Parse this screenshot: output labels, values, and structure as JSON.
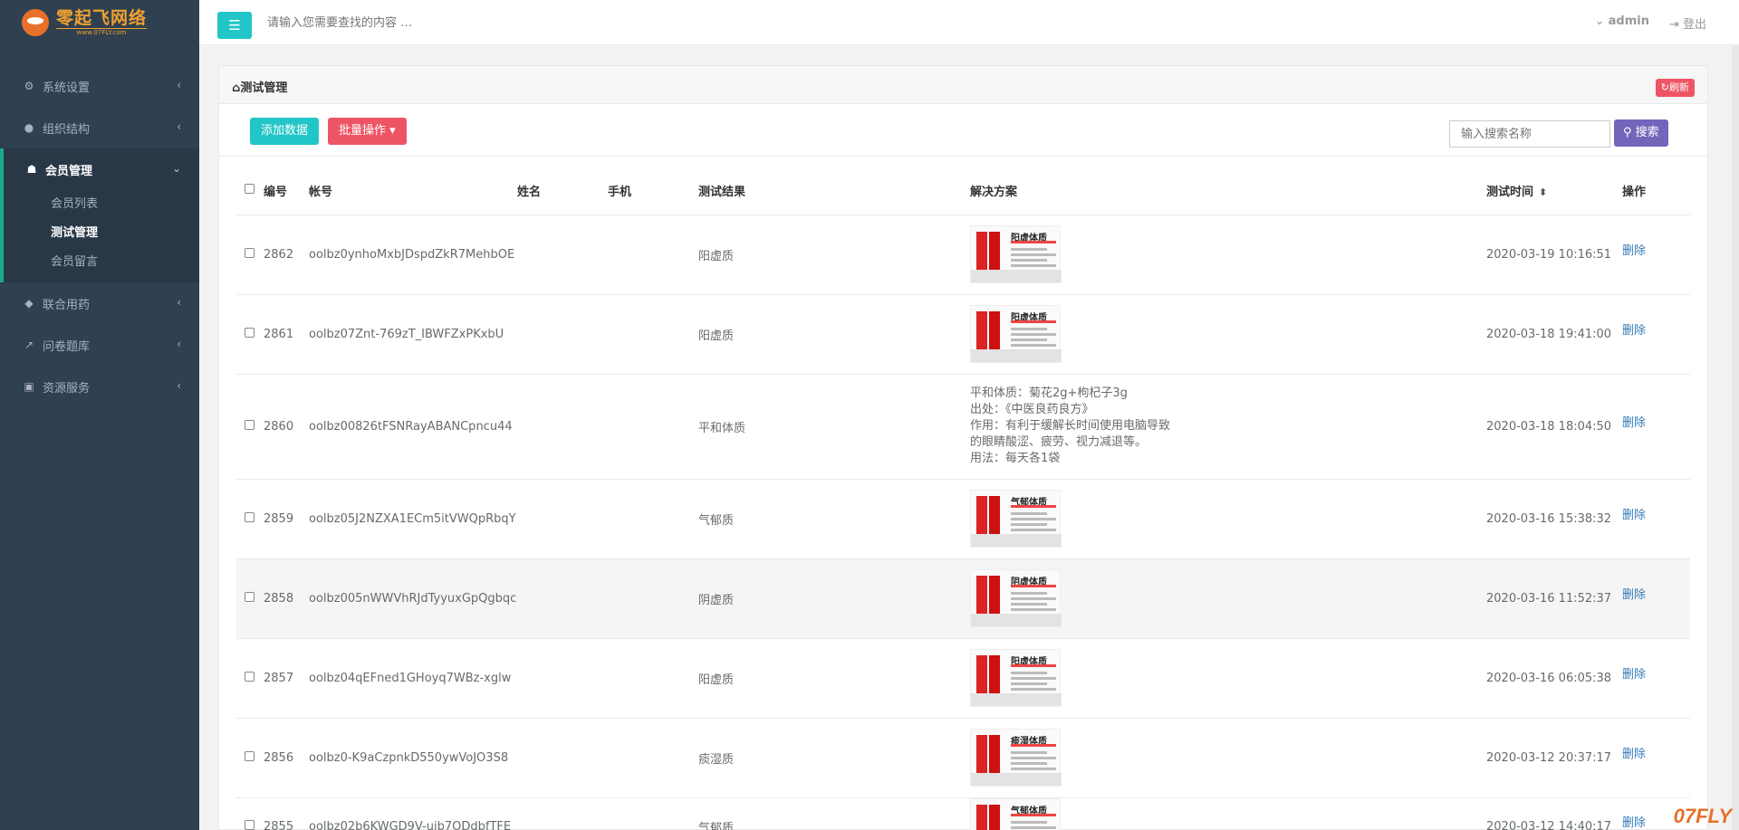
{
  "sidebar": {
    "logo_main": "零起飞网络",
    "logo_sub": "www.07FLY.com",
    "items": [
      {
        "label": "系统设置",
        "icon": "gears-icon",
        "glyph": "⚙"
      },
      {
        "label": "组织结构",
        "icon": "user-icon",
        "glyph": "●"
      },
      {
        "label": "会员管理",
        "icon": "users-icon",
        "glyph": "☗",
        "active": true,
        "sub": [
          {
            "label": "会员列表"
          },
          {
            "label": "测试管理",
            "current": true
          },
          {
            "label": "会员留言"
          }
        ]
      },
      {
        "label": "联合用药",
        "icon": "user-secret-icon",
        "glyph": "◆"
      },
      {
        "label": "问卷题库",
        "icon": "line-chart-icon",
        "glyph": "↗"
      },
      {
        "label": "资源服务",
        "icon": "cube-icon",
        "glyph": "▣"
      }
    ]
  },
  "topbar": {
    "search_placeholder": "请输入您需要查找的内容 …",
    "user": "admin",
    "logout": "登出"
  },
  "panel": {
    "title": "测试管理",
    "refresh": "刷新"
  },
  "toolbar": {
    "add": "添加数据",
    "batch": "批量操作",
    "search_placeholder": "输入搜索名称",
    "search": "搜索"
  },
  "table": {
    "headers": {
      "id": "编号",
      "account": "帐号",
      "name": "姓名",
      "phone": "手机",
      "result": "测试结果",
      "solution": "解决方案",
      "time": "测试时间",
      "action": "操作"
    },
    "delete_label": "删除",
    "rows": [
      {
        "id": "2862",
        "account": "oolbz0ynhoMxbJDspdZkR7MehbOE",
        "result": "阳虚质",
        "solution_title": "阳虚体质",
        "time": "2020-03-19 10:16:51"
      },
      {
        "id": "2861",
        "account": "oolbz07Znt-769zT_IBWFZxPKxbU",
        "result": "阳虚质",
        "solution_title": "阳虚体质",
        "time": "2020-03-18 19:41:00"
      },
      {
        "id": "2860",
        "account": "oolbz00826tFSNRayABANCpncu44",
        "result": "平和体质",
        "solution_lines": [
          "平和体质：菊花2g+枸杞子3g",
          "出处：《中医良药良方》",
          "作用：有利于缓解长时间使用电脑导致",
          "的眼睛酸涩、疲劳、视力减退等。",
          "用法：每天各1袋"
        ],
        "time": "2020-03-18 18:04:50"
      },
      {
        "id": "2859",
        "account": "oolbz05J2NZXA1ECm5itVWQpRbqY",
        "result": "气郁质",
        "solution_title": "气郁体质",
        "time": "2020-03-16 15:38:32"
      },
      {
        "id": "2858",
        "account": "oolbz005nWWVhRJdTyyuxGpQgbqc",
        "result": "阴虚质",
        "solution_title": "阴虚体质",
        "time": "2020-03-16 11:52:37",
        "highlight": true
      },
      {
        "id": "2857",
        "account": "oolbz04qEFned1GHoyq7WBz-xglw",
        "result": "阳虚质",
        "solution_title": "阳虚体质",
        "time": "2020-03-16 06:05:38"
      },
      {
        "id": "2856",
        "account": "oolbz0-K9aCzpnkD550ywVoJO3S8",
        "result": "痰湿质",
        "solution_title": "痰湿体质",
        "time": "2020-03-12 20:37:17"
      },
      {
        "id": "2855",
        "account": "oolbz02b6KWGD9V-ujb7ODdbfTFE",
        "result": "气郁质",
        "solution_title": "气郁体质",
        "time": "2020-03-12 14:40:17"
      }
    ]
  },
  "watermark": "07FLY"
}
